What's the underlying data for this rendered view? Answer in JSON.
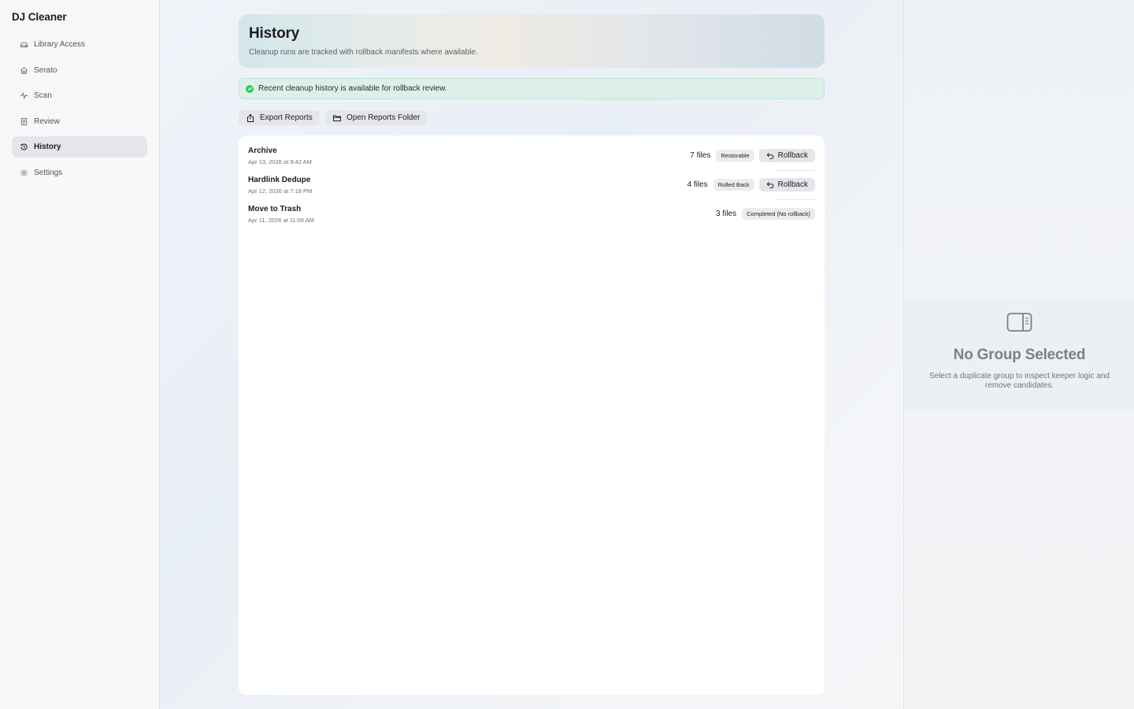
{
  "app": {
    "title": "DJ Cleaner"
  },
  "sidebar": {
    "items": [
      {
        "label": "Library Access",
        "icon": "drive-icon",
        "active": false
      },
      {
        "label": "Serato",
        "icon": "home-icon",
        "active": false
      },
      {
        "label": "Scan",
        "icon": "waveform-icon",
        "active": false
      },
      {
        "label": "Review",
        "icon": "document-icon",
        "active": false
      },
      {
        "label": "History",
        "icon": "clock-history-icon",
        "active": true
      },
      {
        "label": "Settings",
        "icon": "gear-icon",
        "active": false
      }
    ]
  },
  "header": {
    "title": "History",
    "subtitle": "Cleanup runs are tracked with rollback manifests where available."
  },
  "banner": {
    "text": "Recent cleanup history is available for rollback review.",
    "status_color": "#34c759"
  },
  "toolbar": {
    "export_label": "Export Reports",
    "open_folder_label": "Open Reports Folder"
  },
  "history": {
    "rows": [
      {
        "name": "Archive",
        "date": "Apr 13, 2026 at 9:42 AM",
        "files": "7 files",
        "status": "Restorable",
        "action": "Rollback"
      },
      {
        "name": "Hardlink Dedupe",
        "date": "Apr 12, 2026 at 7:18 PM",
        "files": "4 files",
        "status": "Rolled Back",
        "action": "Rollback"
      },
      {
        "name": "Move to Trash",
        "date": "Apr 11, 2026 at 11:06 AM",
        "files": "3 files",
        "status": "Completed (No rollback)",
        "action": ""
      }
    ]
  },
  "inspector": {
    "empty_title": "No Group Selected",
    "empty_subtitle": "Select a duplicate group to inspect keeper logic and remove candidates.",
    "icon": "sidebar-right-icon"
  }
}
